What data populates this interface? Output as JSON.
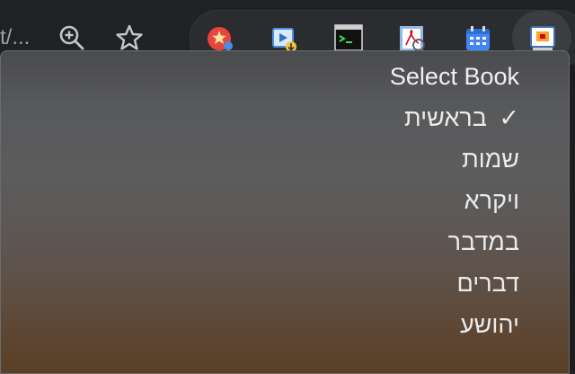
{
  "toolbar": {
    "url_fragment": "t/...",
    "zoom_icon": "zoom-in-icon",
    "bookmark_icon": "star-icon"
  },
  "extensions": [
    {
      "name": "extension-red-star-icon",
      "color": "#e8453c"
    },
    {
      "name": "extension-video-download-icon",
      "color": "#4a90e2"
    },
    {
      "name": "extension-terminal-icon",
      "color": "#000000"
    },
    {
      "name": "extension-pdf-tool-icon",
      "color": "#4a90e2"
    },
    {
      "name": "extension-calendar-icon",
      "color": "#4285f4"
    },
    {
      "name": "extension-active-app-icon",
      "color": "#f5a623"
    }
  ],
  "menu": {
    "header": "Select Book",
    "check_mark": "✓",
    "items": [
      {
        "label": "בראשית",
        "selected": true
      },
      {
        "label": "שמות",
        "selected": false
      },
      {
        "label": "ויקרא",
        "selected": false
      },
      {
        "label": "במדבר",
        "selected": false
      },
      {
        "label": "דברים",
        "selected": false
      },
      {
        "label": "יהושע",
        "selected": false
      }
    ]
  }
}
